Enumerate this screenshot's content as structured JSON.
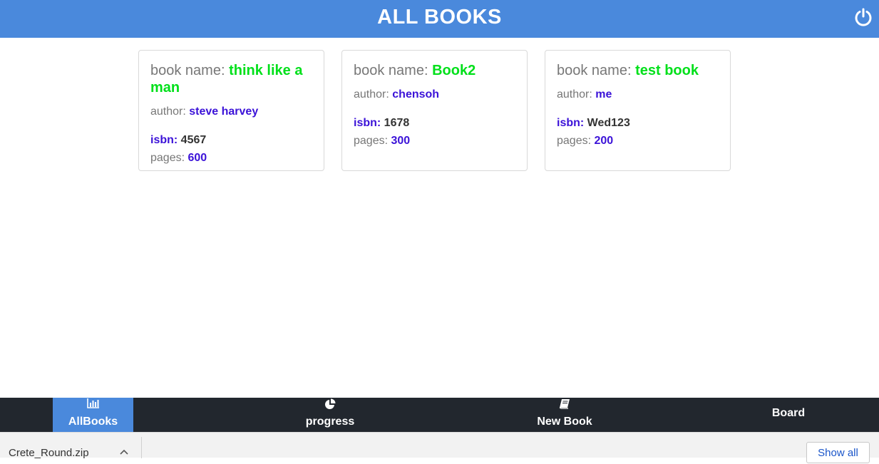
{
  "header": {
    "title": "ALL BOOKS",
    "power_icon": "power-icon"
  },
  "books": [
    {
      "name_label": "book name: ",
      "name": "think like a man",
      "author_label": "author: ",
      "author": "steve harvey",
      "isbn_label": "isbn: ",
      "isbn": "4567",
      "pages_label": "pages: ",
      "pages": "600"
    },
    {
      "name_label": "book name: ",
      "name": "Book2",
      "author_label": "author: ",
      "author": "chensoh",
      "isbn_label": "isbn: ",
      "isbn": "1678",
      "pages_label": "pages: ",
      "pages": "300"
    },
    {
      "name_label": "book name: ",
      "name": "test book",
      "author_label": "author: ",
      "author": "me",
      "isbn_label": "isbn: ",
      "isbn": "Wed123",
      "pages_label": "pages: ",
      "pages": "200"
    }
  ],
  "nav": {
    "items": [
      {
        "label": "AllBooks",
        "icon": "bar-chart-icon",
        "active": true
      },
      {
        "label": "progress",
        "icon": "pie-chart-icon",
        "active": false
      },
      {
        "label": "New Book",
        "icon": "book-icon",
        "active": false
      },
      {
        "label": "Board",
        "icon": "",
        "active": false
      }
    ]
  },
  "downloads": {
    "file": "Crete_Round.zip",
    "show_all": "Show all"
  },
  "colors": {
    "header": "#4a89dc",
    "nav": "#22272e",
    "book_name": "#00e01a",
    "value_blue": "#3b12d8"
  }
}
